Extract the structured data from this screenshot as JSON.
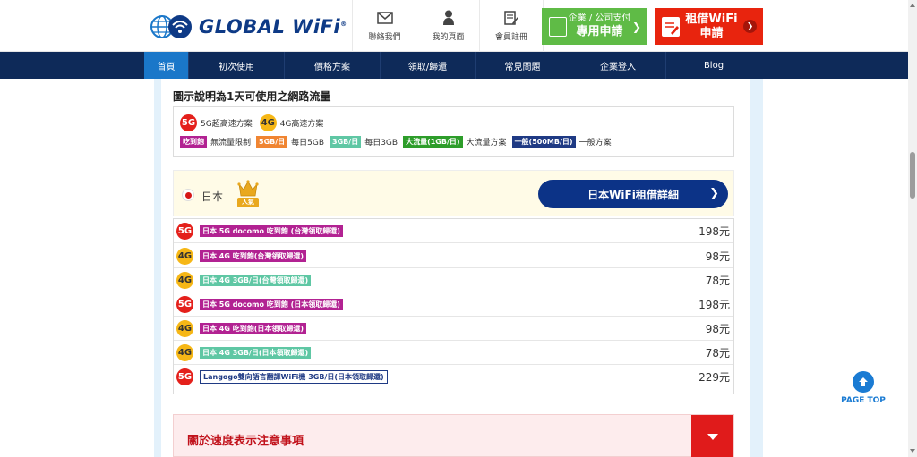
{
  "header": {
    "logo_text": "GLOBAL WiFi",
    "logo_reg": "®",
    "nav": [
      {
        "label": "聯絡我們",
        "icon": "mail-icon"
      },
      {
        "label": "我的頁面",
        "icon": "user-icon"
      },
      {
        "label": "會員註冊",
        "icon": "edit-icon"
      }
    ],
    "corp_button": {
      "line1": "企業 / 公司支付",
      "line2": "專用申請"
    },
    "rent_button": {
      "line1": "租借WiFi",
      "line2": "申請"
    }
  },
  "navbar": [
    "首頁",
    "初次使用",
    "價格方案",
    "領取/歸還",
    "常見問題",
    "企業登入",
    "Blog"
  ],
  "intro": "圖示說明為1天可使用之網路流量",
  "legend": {
    "badge_5g": "5G",
    "badge_4g": "4G",
    "label_5g": "5G超高速方案",
    "label_4g": "4G高速方案",
    "items": [
      {
        "tag": "吃到飽",
        "desc": "無流量限制",
        "color": "pink"
      },
      {
        "tag": "5GB/日",
        "desc": "每日5GB",
        "color": "orange"
      },
      {
        "tag": "3GB/日",
        "desc": "每日3GB",
        "color": "teal"
      },
      {
        "tag": "大流量(1GB/日)",
        "desc": "大流量方案",
        "color": "green"
      },
      {
        "tag": "一般(500MB/日)",
        "desc": "一般方案",
        "color": "navy"
      }
    ]
  },
  "country": {
    "name": "日本",
    "popular": "人氣",
    "detail_button": "日本WiFi租借詳細"
  },
  "plans": [
    {
      "network": "5G",
      "name": "日本 5G docomo 吃到飽 (台灣領取歸還)",
      "style": "pink",
      "price": "198元"
    },
    {
      "network": "4G",
      "name": "日本 4G 吃到飽(台灣領取歸還)",
      "style": "pink",
      "price": "98元"
    },
    {
      "network": "4G",
      "name": "日本 4G 3GB/日(台灣領取歸還)",
      "style": "teal",
      "price": "78元"
    },
    {
      "network": "5G",
      "name": "日本 5G docomo 吃到飽 (日本領取歸還)",
      "style": "pink",
      "price": "198元"
    },
    {
      "network": "4G",
      "name": "日本 4G 吃到飽(日本領取歸還)",
      "style": "pink",
      "price": "98元"
    },
    {
      "network": "4G",
      "name": "日本 4G 3GB/日(日本領取歸還)",
      "style": "teal",
      "price": "78元"
    },
    {
      "network": "5G",
      "name": "Langogo雙向語言翻譯WiFi機 3GB/日(日本領取歸還)",
      "style": "outline",
      "price": "229元"
    }
  ],
  "notice": {
    "title": "關於速度表示注意事項"
  },
  "pagetop": "PAGE TOP",
  "colors": {
    "navy": "#0e2a59",
    "brand_blue": "#0e3a86",
    "green": "#5fbb46",
    "red": "#e8240e",
    "active_tab": "#1a77c9"
  }
}
